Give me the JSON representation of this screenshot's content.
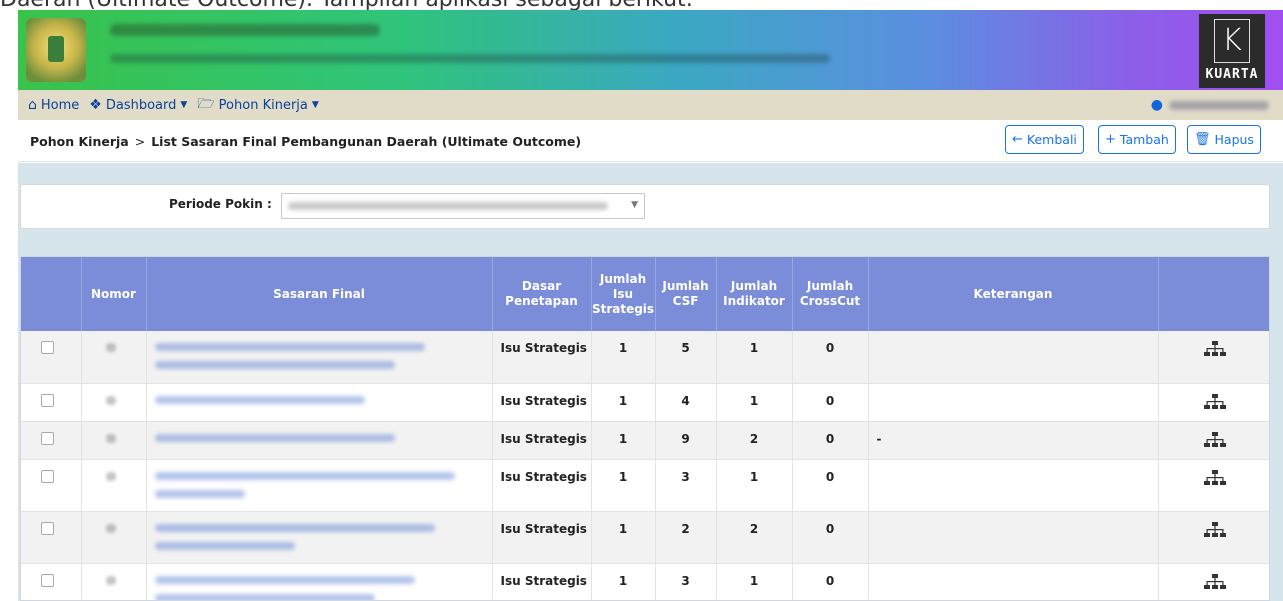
{
  "caption": "Daerah (Ultimate Outcome). Tampilan aplikasi sebagai berikut:",
  "brand": {
    "logo_text": "KUARTA",
    "logo_letter": "K"
  },
  "nav": {
    "items": [
      {
        "label": "Home",
        "icon": "home-icon"
      },
      {
        "label": "Dashboard",
        "icon": "dashboard-icon",
        "dropdown": true
      },
      {
        "label": "Pohon Kinerja",
        "icon": "folder-open-icon",
        "dropdown": true
      }
    ],
    "user_icon": "user-icon"
  },
  "breadcrumb": {
    "root": "Pohon Kinerja",
    "separator": ">",
    "current": "List Sasaran Final Pembangunan Daerah (Ultimate Outcome)"
  },
  "actions": {
    "back": "Kembali",
    "add": "Tambah",
    "delete": "Hapus"
  },
  "filter": {
    "label": "Periode Pokin :"
  },
  "table": {
    "headers": {
      "nomor": "Nomor",
      "sasaran": "Sasaran Final",
      "dasar": "Dasar Penetapan",
      "isu": "Jumlah Isu Strategis",
      "csf": "Jumlah CSF",
      "indikator": "Jumlah Indikator",
      "crosscut": "Jumlah CrossCut",
      "keterangan": "Keterangan"
    },
    "rows": [
      {
        "dasar": "Isu Strategis",
        "isu": "1",
        "csf": "5",
        "indikator": "1",
        "crosscut": "0",
        "keterangan": ""
      },
      {
        "dasar": "Isu Strategis",
        "isu": "1",
        "csf": "4",
        "indikator": "1",
        "crosscut": "0",
        "keterangan": ""
      },
      {
        "dasar": "Isu Strategis",
        "isu": "1",
        "csf": "9",
        "indikator": "2",
        "crosscut": "0",
        "keterangan": "-"
      },
      {
        "dasar": "Isu Strategis",
        "isu": "1",
        "csf": "3",
        "indikator": "1",
        "crosscut": "0",
        "keterangan": ""
      },
      {
        "dasar": "Isu Strategis",
        "isu": "1",
        "csf": "2",
        "indikator": "2",
        "crosscut": "0",
        "keterangan": ""
      },
      {
        "dasar": "Isu Strategis",
        "isu": "1",
        "csf": "3",
        "indikator": "1",
        "crosscut": "0",
        "keterangan": ""
      }
    ]
  }
}
